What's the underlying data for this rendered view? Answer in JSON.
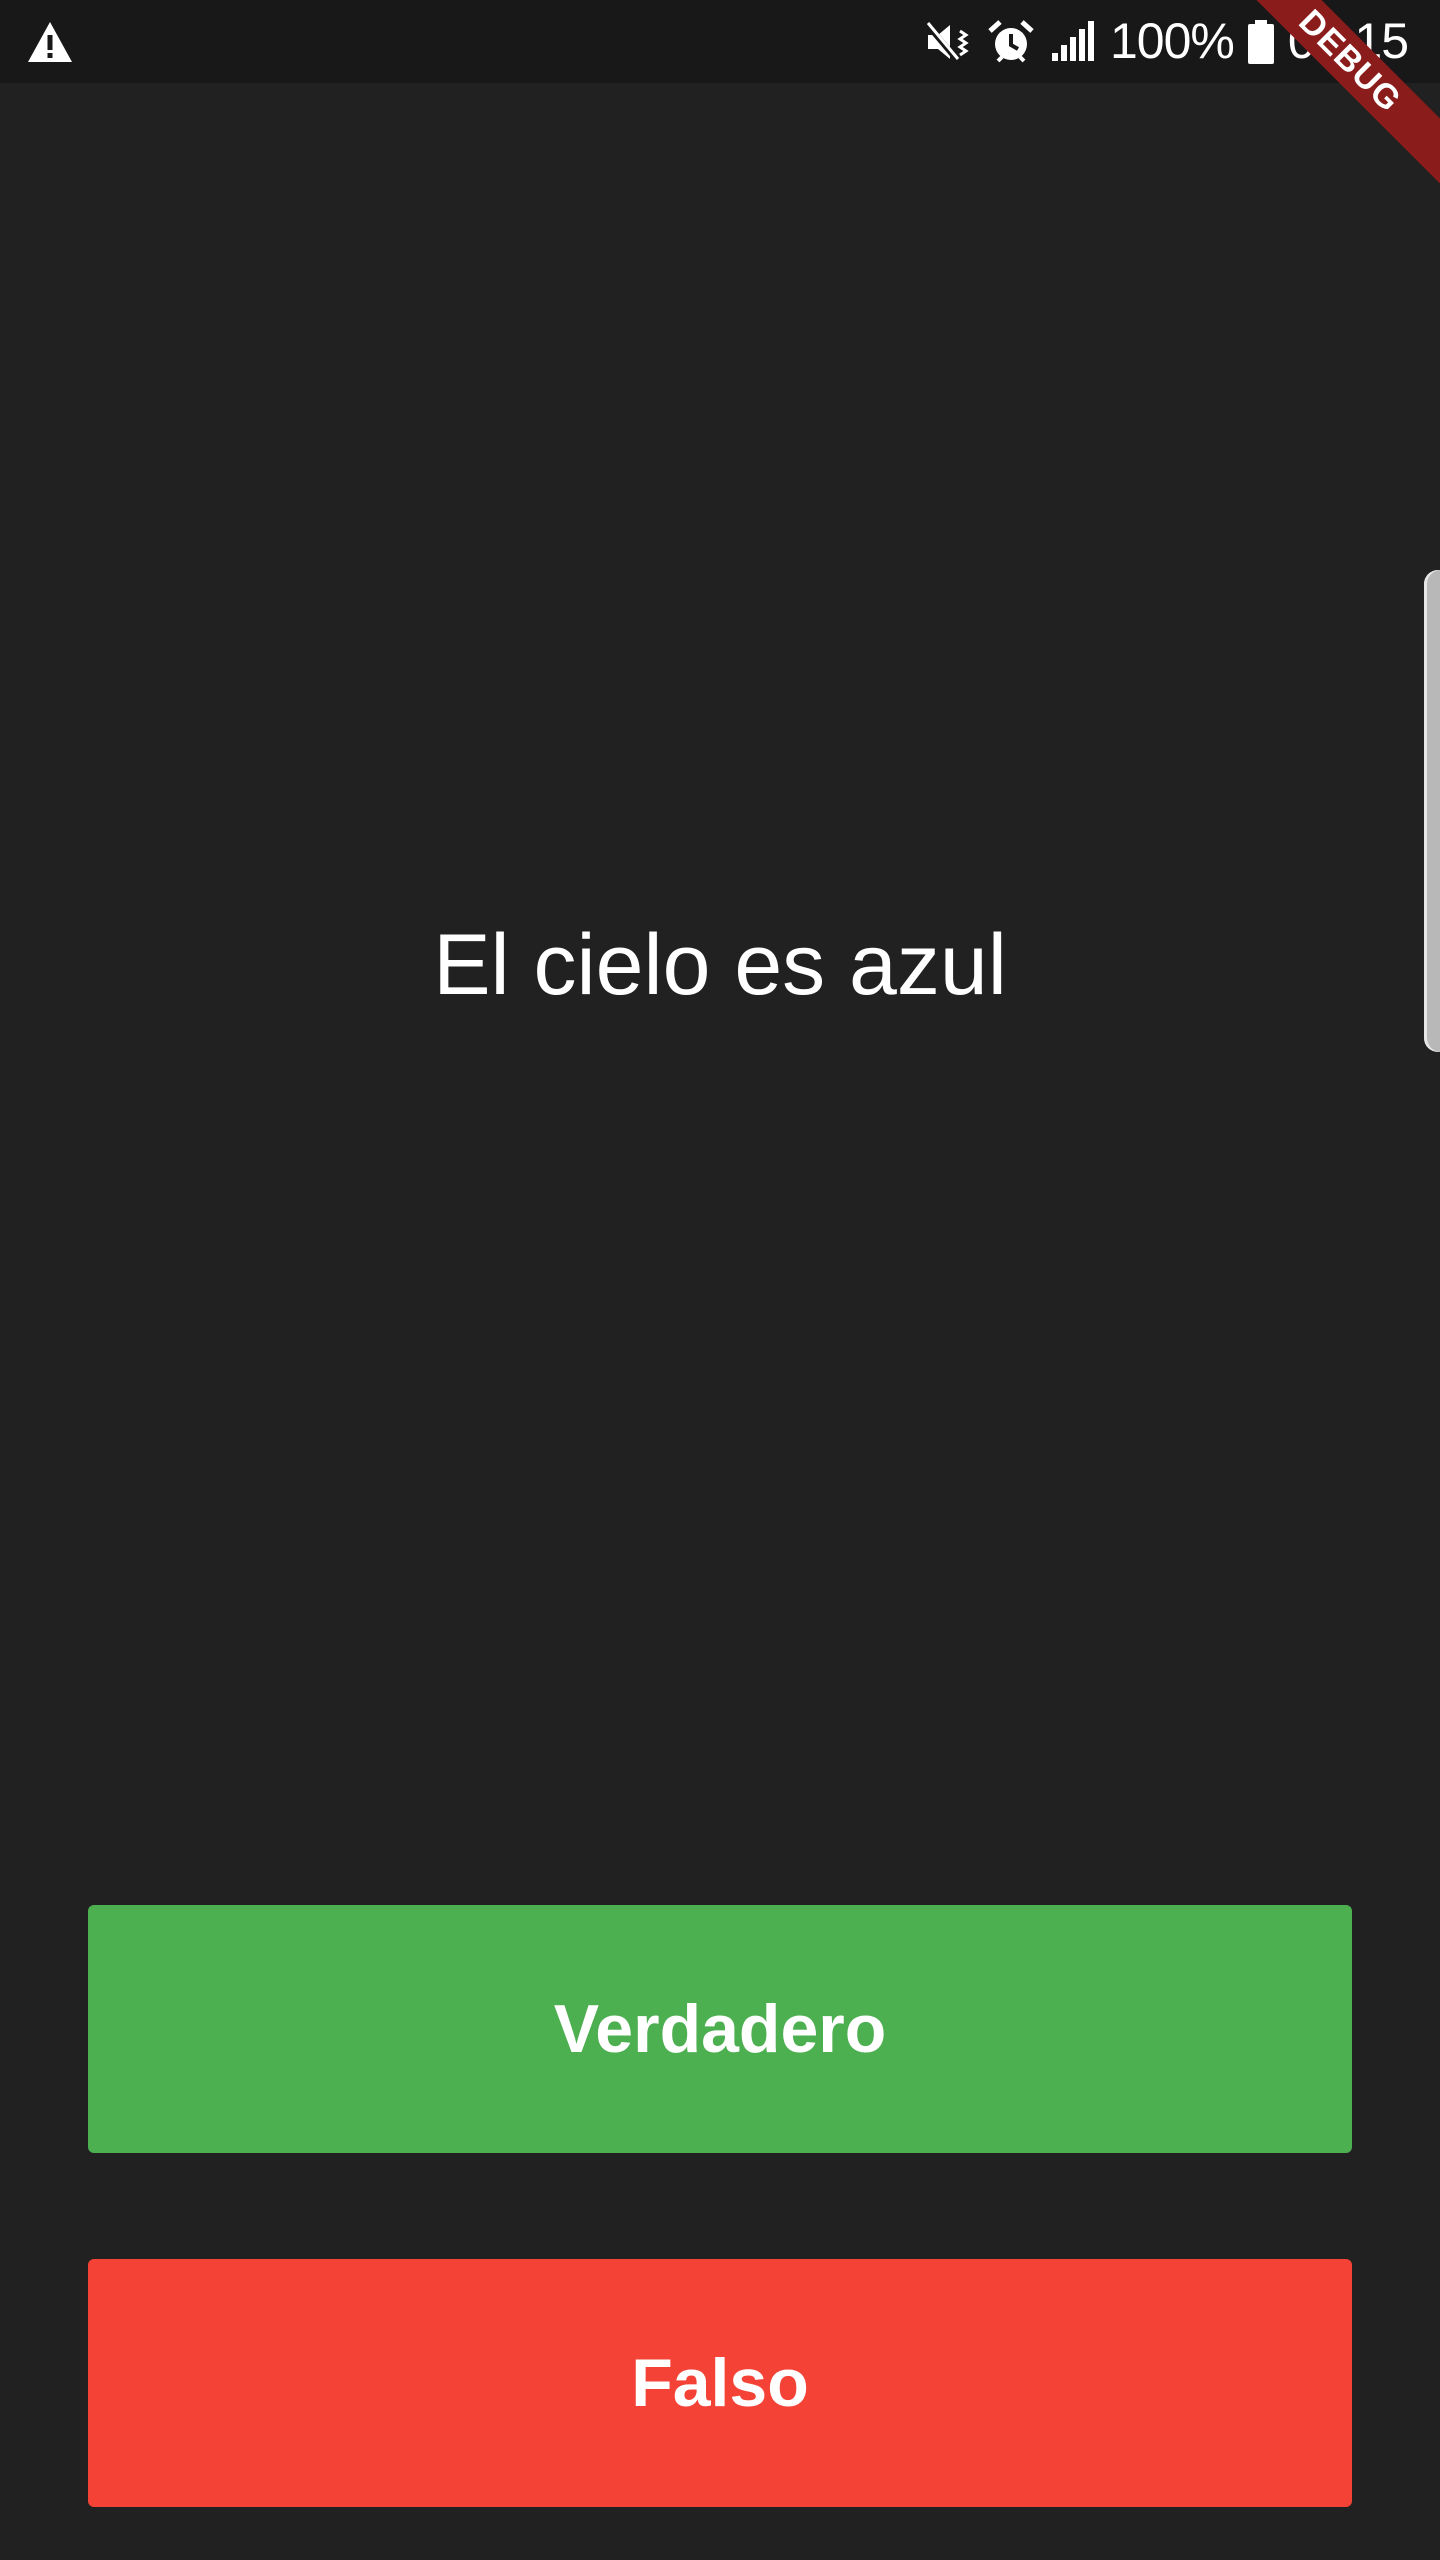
{
  "status_bar": {
    "battery_percent": "100%",
    "time": "06:15",
    "icons": [
      "warning-icon",
      "mute-icon",
      "alarm-icon",
      "signal-icon",
      "battery-icon"
    ]
  },
  "debug_banner": "DEBUG",
  "quiz": {
    "question": "El cielo es azul",
    "true_label": "Verdadero",
    "false_label": "Falso"
  },
  "colors": {
    "background": "#212121",
    "status_bar": "#181818",
    "true_button": "#4caf50",
    "false_button": "#f44336",
    "debug_banner": "#8b1c1c"
  }
}
